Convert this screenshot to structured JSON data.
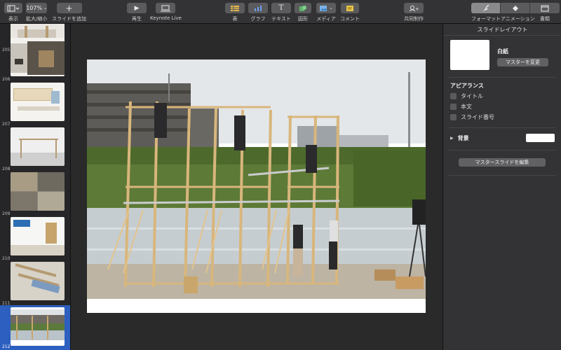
{
  "toolbar": {
    "view_label": "表示",
    "zoom_value": "107%",
    "zoom_label": "拡大/縮小",
    "add_slide_label": "スライドを追加",
    "play_label": "再生",
    "keynote_live_label": "Keynote Live",
    "table_label": "表",
    "chart_label": "グラフ",
    "text_label": "テキスト",
    "shape_label": "図形",
    "media_label": "メディア",
    "comment_label": "コメント",
    "collaborate_label": "共同制作",
    "format_label": "フォーマット",
    "animate_label": "アニメーション",
    "document_label": "書類"
  },
  "navigator": {
    "slides": [
      {
        "number": "205"
      },
      {
        "number": "206"
      },
      {
        "number": "207"
      },
      {
        "number": "208"
      },
      {
        "number": "209"
      },
      {
        "number": "210"
      },
      {
        "number": "211"
      },
      {
        "number": "212",
        "selected": true
      }
    ]
  },
  "inspector": {
    "title": "スライドレイアウト",
    "master_name": "白紙",
    "change_master_label": "マスターを変更",
    "appearance_label": "アピアランス",
    "checkboxes": [
      "タイトル",
      "本文",
      "スライド番号"
    ],
    "background_label": "背景",
    "edit_master_label": "マスタースライドを編集"
  },
  "colors": {
    "accent": "#2c5fbf",
    "panel": "#333335",
    "canvas": "#2a2a2a"
  }
}
